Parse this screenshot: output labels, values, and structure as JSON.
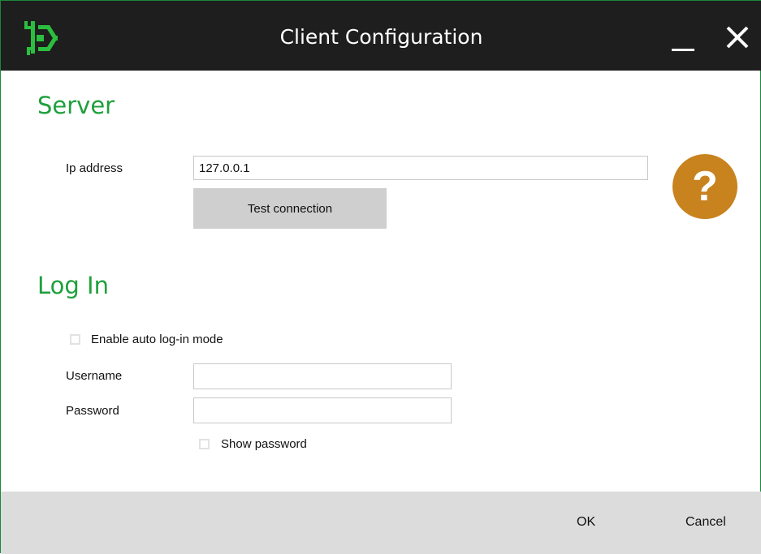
{
  "window": {
    "title": "Client Configuration"
  },
  "server": {
    "heading": "Server",
    "ip_label": "Ip address",
    "ip_value": "127.0.0.1",
    "test_button": "Test connection"
  },
  "login": {
    "heading": "Log In",
    "auto_login_label": "Enable auto log-in mode",
    "auto_login_checked": false,
    "username_label": "Username",
    "username_value": "",
    "password_label": "Password",
    "password_value": "",
    "show_password_label": "Show password",
    "show_password_checked": false
  },
  "footer": {
    "ok_label": "OK",
    "cancel_label": "Cancel"
  },
  "icons": {
    "app": "wrench-gear-logo-icon",
    "minimize": "minimize-icon",
    "close": "close-icon",
    "help": "help-question-icon"
  },
  "colors": {
    "titlebar": "#1e1e1e",
    "accent_green": "#1fa03c",
    "help_orange": "#c8821e",
    "footer": "#dcdcdc",
    "button": "#cfcfcf"
  }
}
